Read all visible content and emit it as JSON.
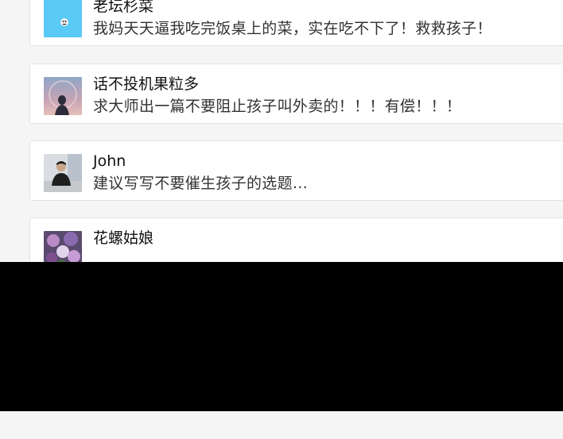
{
  "comments": [
    {
      "user": "老坛杉菜",
      "text": "我妈天天逼我吃完饭桌上的菜，实在吃不下了！救救孩子！",
      "avatar_icon": "cartoon-face-avatar-icon"
    },
    {
      "user": "话不投机果粒多",
      "text": "求大师出一篇不要阻止孩子叫外卖的！！！有偿！！！",
      "avatar_icon": "silhouette-sunset-avatar-icon"
    },
    {
      "user": "John",
      "text": "建议写写不要催生孩子的选题…",
      "avatar_icon": "man-portrait-avatar-icon"
    },
    {
      "user": "花螺姑娘",
      "text": "",
      "avatar_icon": "flowers-avatar-icon"
    }
  ],
  "colors": {
    "background": "#f5f5f5",
    "card": "#ffffff",
    "name_text": "#111111",
    "comment_text": "#333333",
    "redaction_block": "#000000"
  }
}
